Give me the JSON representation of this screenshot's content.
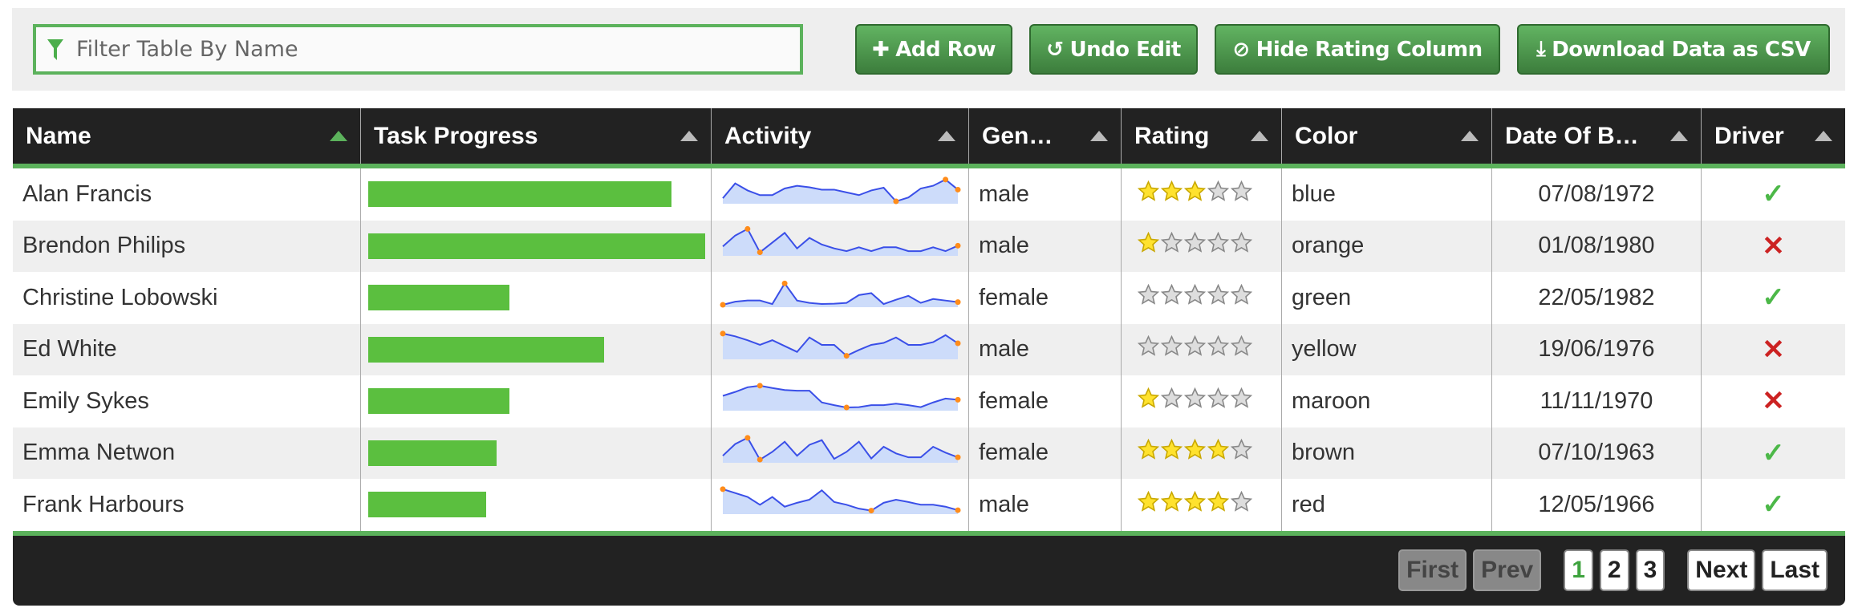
{
  "toolbar": {
    "filter_placeholder": "Filter Table By Name",
    "buttons": [
      {
        "label": "Add Row",
        "icon": "plus-icon"
      },
      {
        "label": "Undo Edit",
        "icon": "undo-icon"
      },
      {
        "label": "Hide Rating Column",
        "icon": "eye-slash-icon"
      },
      {
        "label": "Download Data as CSV",
        "icon": "download-icon"
      }
    ]
  },
  "columns": [
    "Name",
    "Task Progress",
    "Activity",
    "Gen…",
    "Rating",
    "Color",
    "Date Of B…",
    "Driver"
  ],
  "sorted_column": "Name",
  "colors": {
    "accent": "#5cb25c",
    "progress": "#5bbf3f",
    "spark_line": "#3a4fe8",
    "spark_fill": "#cddcfa",
    "spark_marker": "#ff8c1a",
    "star_on": "#ffe22e",
    "check": "#4cb848",
    "cross": "#cc2222"
  },
  "rows": [
    {
      "name": "Alan Francis",
      "progress": 90,
      "activity": [
        10,
        48,
        30,
        18,
        18,
        35,
        42,
        38,
        32,
        32,
        25,
        18,
        30,
        37,
        2,
        12,
        35,
        42,
        58,
        32
      ],
      "gender": "male",
      "rating": 3,
      "color": "blue",
      "dob": "07/08/1972",
      "driver": true
    },
    {
      "name": "Brendon Philips",
      "progress": 100,
      "activity": [
        20,
        48,
        65,
        5,
        30,
        55,
        15,
        42,
        25,
        15,
        8,
        18,
        8,
        18,
        18,
        8,
        8,
        18,
        8,
        22
      ],
      "gender": "male",
      "rating": 1,
      "color": "orange",
      "dob": "01/08/1980",
      "driver": false
    },
    {
      "name": "Christine Lobowski",
      "progress": 42,
      "activity": [
        2,
        10,
        13,
        13,
        4,
        57,
        13,
        7,
        4,
        5,
        7,
        27,
        32,
        4,
        15,
        25,
        7,
        17,
        13,
        9
      ],
      "gender": "female",
      "rating": 0,
      "color": "green",
      "dob": "22/05/1982",
      "driver": true
    },
    {
      "name": "Ed White",
      "progress": 70,
      "activity": [
        62,
        55,
        45,
        33,
        45,
        30,
        15,
        52,
        33,
        33,
        5,
        20,
        33,
        38,
        52,
        33,
        33,
        40,
        58,
        37
      ],
      "gender": "male",
      "rating": 0,
      "color": "yellow",
      "dob": "19/06/1976",
      "driver": false
    },
    {
      "name": "Emily Sykes",
      "progress": 42,
      "activity": [
        34,
        44,
        56,
        60,
        54,
        49,
        47,
        47,
        17,
        10,
        4,
        5,
        10,
        10,
        14,
        10,
        5,
        17,
        27,
        24
      ],
      "gender": "female",
      "rating": 1,
      "color": "maroon",
      "dob": "11/11/1970",
      "driver": false
    },
    {
      "name": "Emma Netwon",
      "progress": 38,
      "activity": [
        14,
        44,
        60,
        4,
        24,
        50,
        14,
        42,
        54,
        6,
        24,
        50,
        7,
        37,
        20,
        10,
        10,
        37,
        22,
        10
      ],
      "gender": "female",
      "rating": 4,
      "color": "brown",
      "dob": "07/10/1963",
      "driver": true
    },
    {
      "name": "Frank Harbours",
      "progress": 35,
      "activity": [
        60,
        50,
        40,
        20,
        40,
        15,
        25,
        33,
        57,
        27,
        20,
        10,
        5,
        25,
        33,
        27,
        20,
        20,
        15,
        6
      ],
      "gender": "male",
      "rating": 4,
      "color": "red",
      "dob": "12/05/1966",
      "driver": true
    }
  ],
  "pagination": {
    "first": "First",
    "prev": "Prev",
    "pages": [
      "1",
      "2",
      "3"
    ],
    "current": "1",
    "next": "Next",
    "last": "Last"
  }
}
